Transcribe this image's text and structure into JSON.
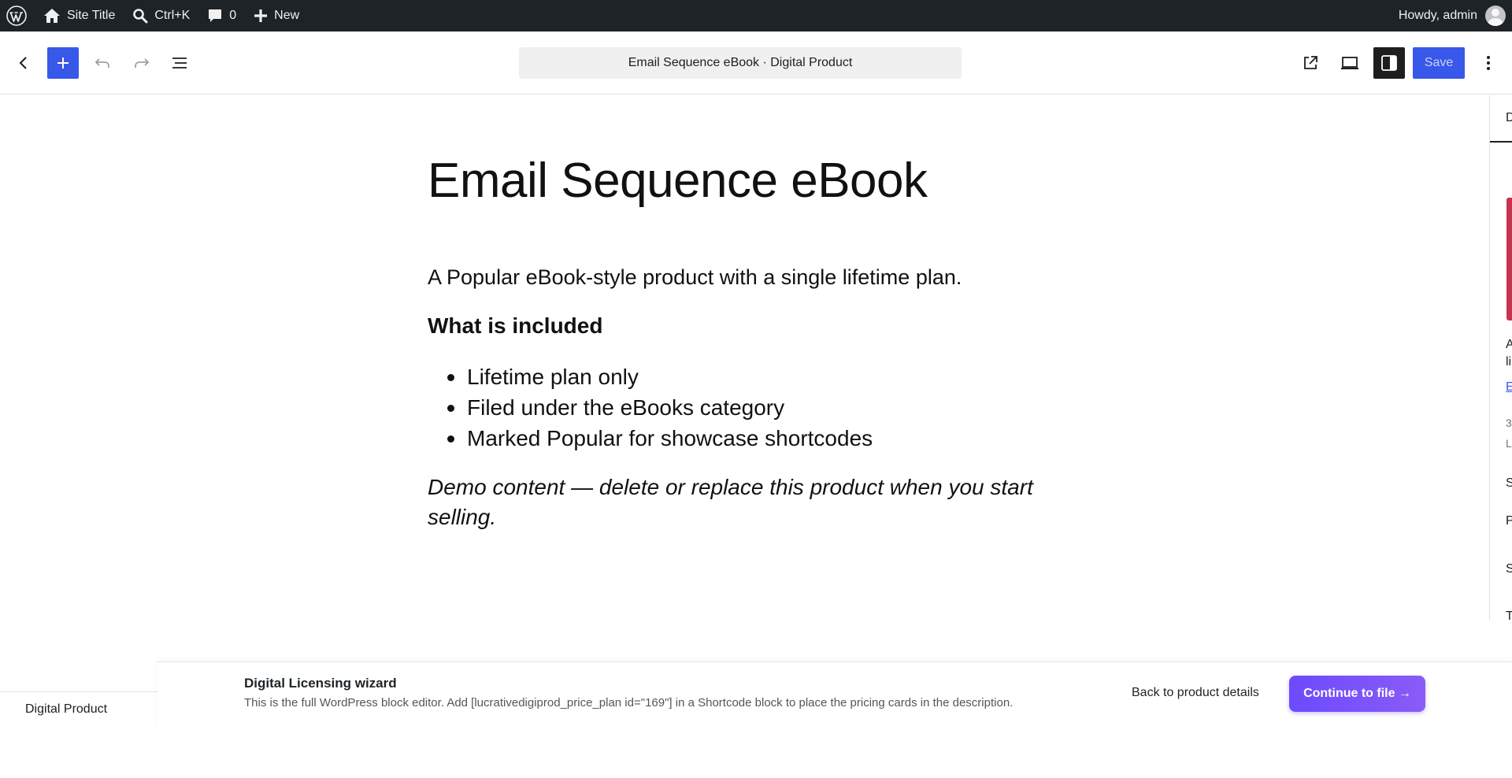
{
  "admin_bar": {
    "site_title": "Site Title",
    "search_shortcut": "Ctrl+K",
    "comments_count": "0",
    "new_label": "New",
    "greeting": "Howdy, admin"
  },
  "editor_header": {
    "document_title": "Email Sequence eBook · Digital Product",
    "save_label": "Save"
  },
  "content": {
    "title": "Email Sequence eBook",
    "lead": "A Popular eBook-style product with a single lifetime plan.",
    "subheading": "What is included",
    "features": [
      "Lifetime plan only",
      "Filed under the eBooks category",
      "Marked Popular for showcase shortcodes"
    ],
    "disclaimer": "Demo content — delete or replace this product when you start selling."
  },
  "sidebar_fragments": [
    "D",
    "A",
    "li",
    "E",
    "3",
    "L",
    "S",
    "P",
    "S",
    "T"
  ],
  "footer": {
    "breadcrumb": "Digital Product"
  },
  "wizard": {
    "title": "Digital Licensing wizard",
    "description": "This is the full WordPress block editor. Add [lucrativedigiprod_price_plan id=\"169\"] in a Shortcode block to place the pricing cards in the description.",
    "back_label": "Back to product details",
    "continue_label": "Continue to file →"
  },
  "colors": {
    "admin_bar_bg": "#1d2327",
    "accent": "#3858e9",
    "wizard_accent": "#6d4aff"
  }
}
